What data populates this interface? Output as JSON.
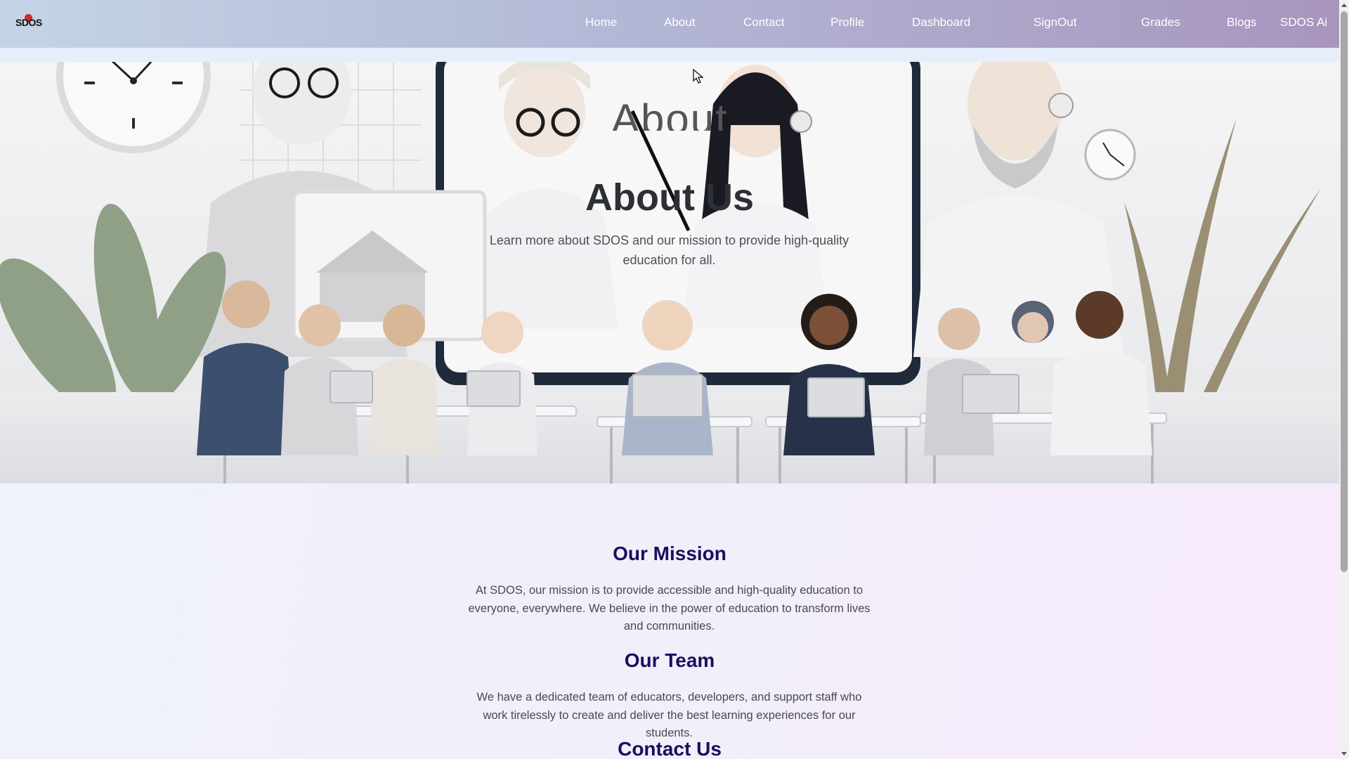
{
  "nav": {
    "logo_text": "SDOS",
    "links": [
      {
        "label": "Home"
      },
      {
        "label": "About"
      },
      {
        "label": "Contact"
      },
      {
        "label": "Profile"
      },
      {
        "label": "Dashboard"
      },
      {
        "label": "SignOut"
      },
      {
        "label": "Grades"
      },
      {
        "label": "Blogs"
      },
      {
        "label": "SDOS Ai"
      }
    ]
  },
  "hero": {
    "ghost_text": "About",
    "title": "About Us",
    "subtitle": "Learn more about SDOS and our mission to provide high-quality education for all."
  },
  "sections": [
    {
      "title": "Our Mission",
      "text": "At SDOS, our mission is to provide accessible and high-quality education to everyone, everywhere. We believe in the power of education to transform lives and communities."
    },
    {
      "title": "Our Team",
      "text": "We have a dedicated team of educators, developers, and support staff who work tirelessly to create and deliver the best learning experiences for our students."
    },
    {
      "title": "Contact Us"
    }
  ],
  "colors": {
    "nav_gradient_start": "#c4d4e6",
    "nav_gradient_end": "#a895bd",
    "heading": "#1a0f5c",
    "body_text": "#4a4a4a",
    "logo_accent": "#d8262d"
  }
}
